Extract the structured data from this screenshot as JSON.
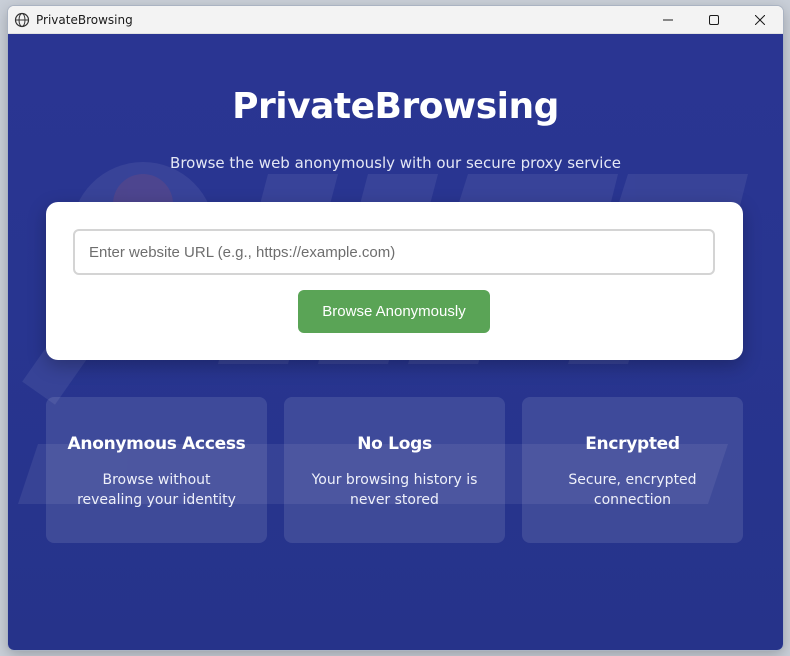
{
  "window": {
    "title": "PrivateBrowsing",
    "icon": "app-globe-icon",
    "controls": [
      "minimize-icon",
      "maximize-icon",
      "close-icon"
    ]
  },
  "hero": {
    "title": "PrivateBrowsing",
    "subtitle": "Browse the web anonymously with our secure proxy service"
  },
  "search": {
    "placeholder": "Enter website URL (e.g., https://example.com)",
    "value": "",
    "button_label": "Browse Anonymously"
  },
  "features": [
    {
      "title": "Anonymous Access",
      "description": "Browse without revealing your identity"
    },
    {
      "title": "No Logs",
      "description": "Your browsing history is never stored"
    },
    {
      "title": "Encrypted",
      "description": "Secure, encrypted connection"
    }
  ],
  "colors": {
    "background": "#283590",
    "button": "#5aa456",
    "card": "#ffffff"
  }
}
